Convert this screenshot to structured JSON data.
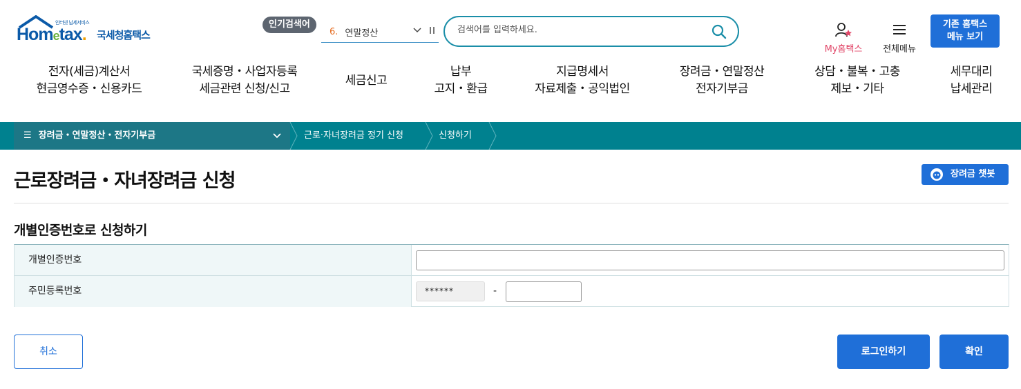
{
  "header": {
    "logo_sub": "인터넷 납세서비스",
    "logo_main_pre": "Hom",
    "logo_main_e": "e",
    "logo_main_post": "tax",
    "logo_dot": ".",
    "logo_kr": "국세청홈택스",
    "popular_badge": "인기검색어",
    "popular_rank": "6.",
    "popular_keyword": "연말정산",
    "search_placeholder": "검색어를 입력하세요.",
    "my_hometax": "My홈택스",
    "all_menu": "전체메뉴",
    "old_menu_line1": "기존 홈택스",
    "old_menu_line2": "메뉴 보기"
  },
  "gnb": [
    {
      "line1": "전자(세금)계산서",
      "line2": "현금영수증・신용카드"
    },
    {
      "line1": "국세증명・사업자등록",
      "line2": "세금관련 신청/신고"
    },
    {
      "line1": "세금신고",
      "line2": ""
    },
    {
      "line1": "납부",
      "line2": "고지・환급"
    },
    {
      "line1": "지급명세서",
      "line2": "자료제출・공익법인"
    },
    {
      "line1": "장려금・연말정산",
      "line2": "전자기부금"
    },
    {
      "line1": "상담・불복・고충",
      "line2": "제보・기타"
    },
    {
      "line1": "세무대리",
      "line2": "납세관리"
    }
  ],
  "breadcrumb": {
    "menu": "장려금・연말정산・전자기부금",
    "level2": "근로·자녀장려금 정기 신청",
    "level3": "신청하기"
  },
  "page": {
    "title": "근로장려금・자녀장려금 신청",
    "chatbot": "장려금 챗봇",
    "section_title": "개별인증번호로 신청하기",
    "row1_label": "개별인증번호",
    "row2_label": "주민등록번호",
    "rrn_front_masked": "******",
    "rrn_dash": "-"
  },
  "buttons": {
    "cancel": "취소",
    "login": "로그인하기",
    "confirm": "확인"
  },
  "colors": {
    "brand_blue": "#1f6fd8",
    "teal_bar": "#00818f",
    "my_hometax_pink": "#e14567"
  }
}
